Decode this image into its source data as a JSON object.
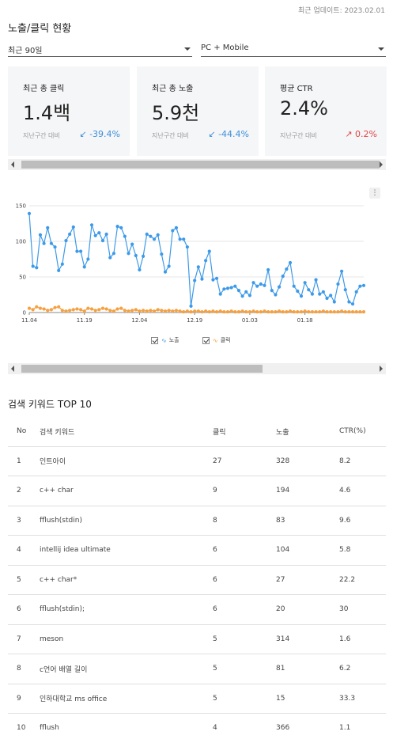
{
  "updated": "최근 업데이트: 2023.02.01",
  "section_title": "노출/클릭 현황",
  "filters": {
    "period": "최근 90일",
    "device": "PC + Mobile"
  },
  "cards": [
    {
      "label": "최근 총 클릭",
      "value": "1.4백",
      "compare": "지난구간 대비",
      "delta": "↙ -39.4%",
      "direction": "down"
    },
    {
      "label": "최근 총 노출",
      "value": "5.9천",
      "compare": "지난구간 대비",
      "delta": "↙ -44.4%",
      "direction": "down"
    },
    {
      "label": "평균 CTR",
      "value": "2.4%",
      "compare": "지난구간 대비",
      "delta": "↗ 0.2%",
      "direction": "up"
    }
  ],
  "chart_menu": "⋮",
  "chart_data": {
    "type": "line",
    "ylim": [
      0,
      150
    ],
    "yticks": [
      "0",
      "50",
      "100",
      "150"
    ],
    "x_ticks": [
      "11.04",
      "11.19",
      "12.04",
      "12.19",
      "01.03",
      "01.18"
    ],
    "x_tick_index": [
      0,
      15,
      30,
      45,
      60,
      75
    ],
    "colors": {
      "impressions": "#3d9ae8",
      "clicks": "#f5a142"
    },
    "series": [
      {
        "name": "노출",
        "values": [
          139,
          65,
          63,
          109,
          97,
          119,
          97,
          92,
          59,
          68,
          101,
          110,
          120,
          86,
          86,
          64,
          75,
          123,
          108,
          112,
          101,
          110,
          77,
          83,
          121,
          119,
          107,
          83,
          96,
          80,
          60,
          79,
          110,
          107,
          103,
          109,
          82,
          57,
          65,
          115,
          119,
          103,
          103,
          92,
          9,
          45,
          64,
          47,
          73,
          86,
          46,
          48,
          26,
          33,
          34,
          35,
          37,
          31,
          23,
          29,
          24,
          42,
          37,
          40,
          38,
          60,
          31,
          25,
          36,
          51,
          61,
          70,
          37,
          30,
          23,
          42,
          32,
          26,
          46,
          26,
          29,
          20,
          24,
          15,
          40,
          58,
          32,
          15,
          12,
          29,
          37,
          38
        ]
      },
      {
        "name": "클릭",
        "values": [
          6,
          4,
          8,
          6,
          5,
          3,
          4,
          7,
          8,
          3,
          2,
          3,
          4,
          5,
          4,
          2,
          6,
          5,
          3,
          4,
          6,
          5,
          3,
          2,
          5,
          6,
          3,
          2,
          3,
          4,
          2,
          3,
          2,
          3,
          2,
          4,
          3,
          2,
          3,
          2,
          3,
          2,
          1,
          2,
          1,
          2,
          2,
          1,
          2,
          1,
          2,
          1,
          2,
          1,
          1,
          2,
          1,
          1,
          2,
          1,
          1,
          2,
          1,
          1,
          2,
          1,
          1,
          1,
          2,
          1,
          1,
          2,
          1,
          1,
          1,
          2,
          1,
          1,
          1,
          1,
          2,
          1,
          1,
          1,
          1,
          2,
          1,
          1,
          1,
          1,
          1,
          1
        ]
      }
    ]
  },
  "keywords": {
    "title": "검색 키워드 TOP 10",
    "headers": [
      "No",
      "검색 키워드",
      "클릭",
      "노출",
      "CTR(%)"
    ],
    "rows": [
      [
        "1",
        "인트아이",
        "27",
        "328",
        "8.2"
      ],
      [
        "2",
        "c++ char",
        "9",
        "194",
        "4.6"
      ],
      [
        "3",
        "fflush(stdin)",
        "8",
        "83",
        "9.6"
      ],
      [
        "4",
        "intellij idea ultimate",
        "6",
        "104",
        "5.8"
      ],
      [
        "5",
        "c++ char*",
        "6",
        "27",
        "22.2"
      ],
      [
        "6",
        "fflush(stdin);",
        "6",
        "20",
        "30"
      ],
      [
        "7",
        "meson",
        "5",
        "314",
        "1.6"
      ],
      [
        "8",
        "c언어 배열 길이",
        "5",
        "81",
        "6.2"
      ],
      [
        "9",
        "인하대학교 ms office",
        "5",
        "15",
        "33.3"
      ],
      [
        "10",
        "fflush",
        "4",
        "366",
        "1.1"
      ]
    ]
  }
}
